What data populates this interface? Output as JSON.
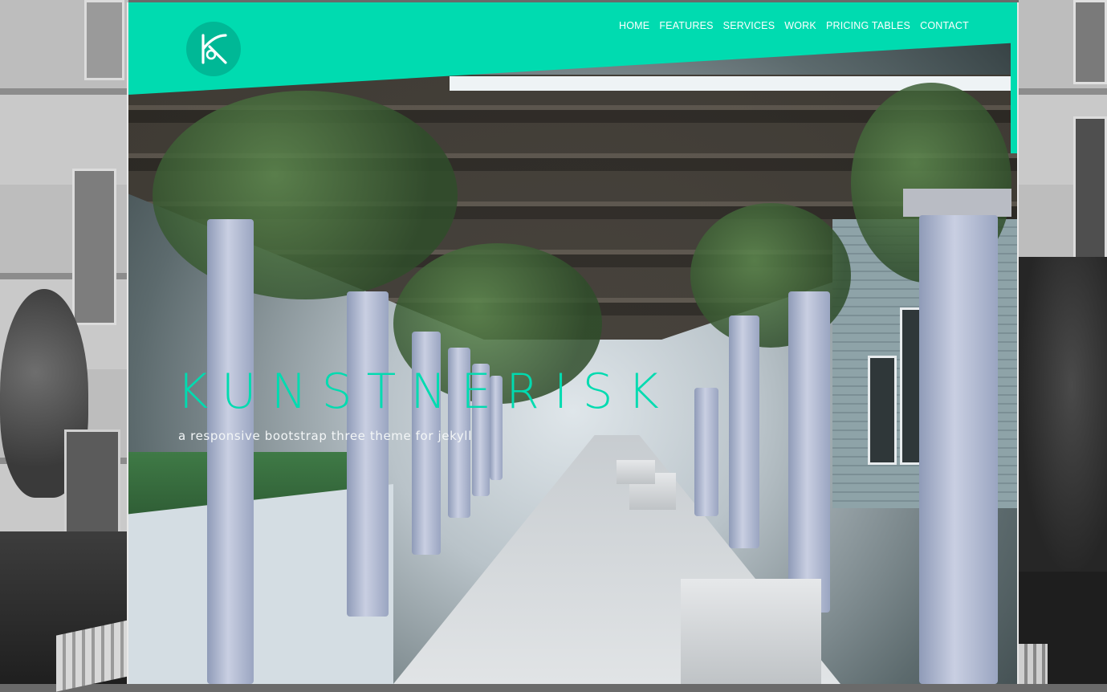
{
  "site": {
    "brand_color": "#00dbb0",
    "logo_icon": "k-logo-icon"
  },
  "nav": {
    "items": [
      "HOME",
      "FEATURES",
      "SERVICES",
      "WORK",
      "PRICING TABLES",
      "CONTACT"
    ]
  },
  "hero": {
    "title": "KUNSTNERISK",
    "subtitle": "a responsive bootstrap three theme for jekyll"
  }
}
